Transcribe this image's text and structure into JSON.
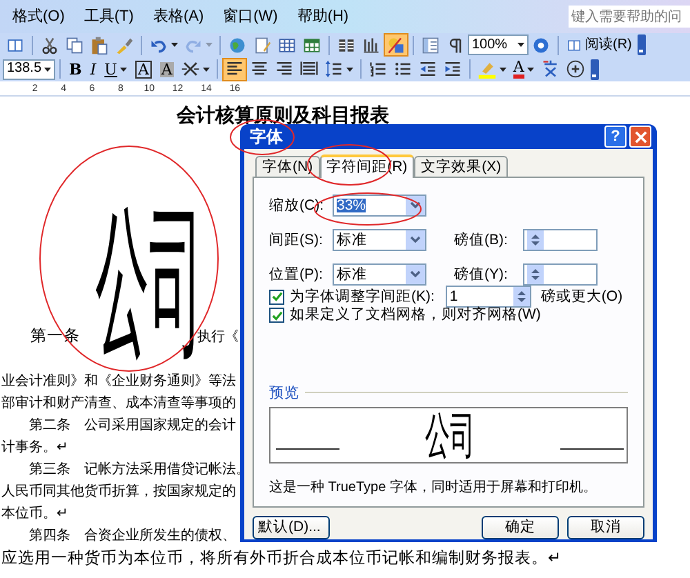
{
  "menu_bar": {
    "items": [
      "格式(O)",
      "工具(T)",
      "表格(A)",
      "窗口(W)",
      "帮助(H)"
    ],
    "help_box": {
      "placeholder": "键入需要帮助的问"
    }
  },
  "standard_toolbar": {
    "items": [
      {
        "kind": "book",
        "pressed": false,
        "disabled": false
      },
      {
        "kind": "separator"
      },
      {
        "kind": "scissors",
        "pressed": false,
        "disabled": false
      },
      {
        "kind": "copy",
        "pressed": false,
        "disabled": false
      },
      {
        "kind": "paste",
        "pressed": false,
        "disabled": false
      },
      {
        "kind": "brush",
        "pressed": false,
        "disabled": false
      },
      {
        "kind": "separator"
      },
      {
        "kind": "undo",
        "pressed": false,
        "disabled": false,
        "dropdown": true
      },
      {
        "kind": "redo",
        "pressed": false,
        "disabled": true,
        "dropdown": true
      },
      {
        "kind": "separator"
      },
      {
        "kind": "globe",
        "pressed": false,
        "disabled": false
      },
      {
        "kind": "docpen",
        "pressed": false,
        "disabled": false
      },
      {
        "kind": "table",
        "pressed": false,
        "disabled": false
      },
      {
        "kind": "sheet",
        "pressed": false,
        "disabled": false
      },
      {
        "kind": "separator"
      },
      {
        "kind": "columns",
        "pressed": false,
        "disabled": false
      },
      {
        "kind": "barchart",
        "pressed": false,
        "disabled": false
      },
      {
        "kind": "drawing",
        "pressed": true,
        "disabled": false
      },
      {
        "kind": "separator"
      },
      {
        "kind": "docmap",
        "pressed": false,
        "disabled": false
      },
      {
        "kind": "pilcrow",
        "pressed": false,
        "disabled": false
      },
      {
        "kind": "combo",
        "value": "100%"
      },
      {
        "kind": "help",
        "pressed": false,
        "disabled": false
      },
      {
        "kind": "separator"
      },
      {
        "kind": "read",
        "label": "阅读(R)"
      }
    ]
  },
  "formatting_toolbar": {
    "items": [
      {
        "kind": "combo",
        "value": "138.5"
      },
      {
        "kind": "separator"
      },
      {
        "kind": "bold",
        "label": "B",
        "pressed": false
      },
      {
        "kind": "italic",
        "label": "I",
        "pressed": false
      },
      {
        "kind": "underline",
        "label": "U",
        "pressed": false,
        "dropdown": true
      },
      {
        "kind": "border",
        "label": "A",
        "pressed": false
      },
      {
        "kind": "shading",
        "label": "A",
        "pressed": false
      },
      {
        "kind": "scale",
        "pressed": false,
        "dropdown": true
      },
      {
        "kind": "separator"
      },
      {
        "kind": "left",
        "pressed": true
      },
      {
        "kind": "center",
        "pressed": false
      },
      {
        "kind": "right",
        "pressed": false
      },
      {
        "kind": "justify",
        "pressed": false
      },
      {
        "kind": "linespacing",
        "pressed": false,
        "dropdown": true
      },
      {
        "kind": "separator"
      },
      {
        "kind": "numbering",
        "pressed": false
      },
      {
        "kind": "bullets",
        "pressed": false
      },
      {
        "kind": "outdent",
        "pressed": false
      },
      {
        "kind": "indent",
        "pressed": false
      },
      {
        "kind": "separator"
      },
      {
        "kind": "highlight",
        "pressed": false,
        "dropdown": true
      },
      {
        "kind": "fontcolor",
        "label": "A",
        "pressed": false,
        "dropdown": true
      },
      {
        "kind": "phonetic",
        "pressed": false
      },
      {
        "kind": "enclose",
        "pressed": false
      }
    ]
  },
  "ruler": {
    "labels": [
      "2",
      "4",
      "6",
      "8",
      "10",
      "12",
      "14",
      "16"
    ]
  },
  "document": {
    "title": "会计核算原则及科目报表",
    "article_one": {
      "label": "第一条",
      "enlarged_text": "公司",
      "after": "执行《"
    },
    "lines": [
      "业会计准则》和《企业财务通则》等法",
      "部审计和财产清查、成本清查等事项的",
      "　　第二条　公司采用国家规定的会计",
      "计事务。↵",
      "　　第三条　记帐方法采用借贷记帐法。",
      "人民币同其他货币折算，按国家规定的",
      "本位币。↵",
      "　　第四条　合资企业所发生的债权、",
      "应选用一种货币为本位币，将所有外币折合成本位币记帐和编制财务报表。↵"
    ]
  },
  "dialog": {
    "title": "字体",
    "help_button": "?",
    "tabs": [
      {
        "label": "字体(N)",
        "selected": false
      },
      {
        "label": "字符间距(R)",
        "selected": true
      },
      {
        "label": "文字效果(X)",
        "selected": false
      }
    ],
    "scale": {
      "label": "缩放(C):",
      "value": "33%",
      "value_selected": true
    },
    "spacing": {
      "label": "间距(S):",
      "value": "标准",
      "by_label": "磅值(B):"
    },
    "position": {
      "label": "位置(P):",
      "value": "标准",
      "by_label": "磅值(Y):"
    },
    "checks": [
      {
        "label": "为字体调整字间距(K):",
        "checked": true,
        "spinner": "1",
        "suffix": "磅或更大(O)"
      },
      {
        "label": "如果定义了文档网格，则对齐网格(W)",
        "checked": true
      }
    ],
    "preview": {
      "label": "预览",
      "sample": "公司",
      "note": "这是一种 TrueType 字体，同时适用于屏幕和打印机。"
    },
    "buttons": [
      "默认(D)...",
      "确定",
      "取消"
    ]
  }
}
